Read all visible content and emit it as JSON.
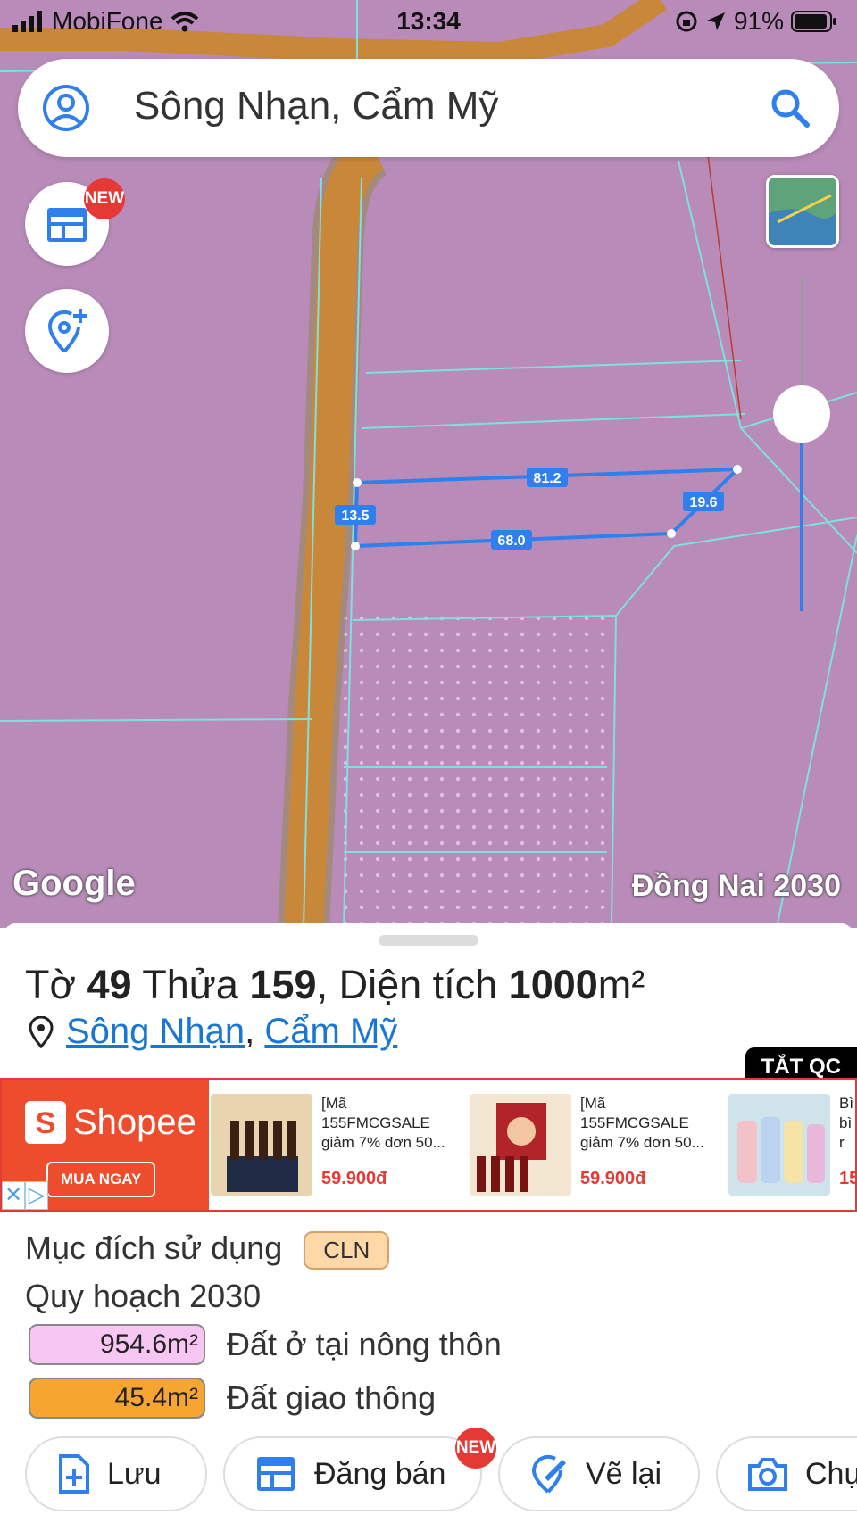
{
  "status_bar": {
    "carrier": "MobiFone",
    "time": "13:34",
    "battery": "91%"
  },
  "search": {
    "query": "Sông Nhạn, Cẩm Mỹ"
  },
  "map": {
    "badge_new": "NEW",
    "attribution": "Google",
    "layer_label": "Đồng Nai 2030",
    "parcel_edges": [
      "81.2",
      "19.6",
      "68.0",
      "13.5"
    ]
  },
  "parcel": {
    "prefix_sheet": "Tờ",
    "sheet_no": "49",
    "prefix_plot": "Thửa",
    "plot_no": "159",
    "prefix_area": ", Diện tích",
    "area": "1000",
    "area_unit": "m²",
    "location_commune": "Sông Nhạn",
    "location_sep": ",",
    "location_district": "Cẩm Mỹ"
  },
  "ad": {
    "close_label": "TẮT QC",
    "brand": "Shopee",
    "buy_label": "MUA NGAY",
    "products": [
      {
        "name": "[Mã 155FMCGSALE giảm 7% đơn 50...",
        "price": "59.900đ"
      },
      {
        "name": "[Mã 155FMCGSALE giảm 7% đơn 50...",
        "price": "59.900đ"
      },
      {
        "name": "Bì bì 2 r",
        "price": "15"
      }
    ]
  },
  "land_use": {
    "purpose_label": "Mục đích sử dụng",
    "purpose_code": "CLN",
    "plan_label": "Quy hoạch 2030",
    "plan_items": [
      {
        "area": "954.6m²",
        "label": "Đất ở tại nông thôn",
        "color": "#f7c6f2"
      },
      {
        "area": "45.4m²",
        "label": "Đất giao thông",
        "color": "#f7a531"
      }
    ]
  },
  "actions": {
    "save": "Lưu",
    "list_for_sale": "Đăng bán",
    "list_badge": "NEW",
    "redraw": "Vẽ lại",
    "photo": "Chụ"
  },
  "colors": {
    "map_bg": "#b88bb8",
    "parcel_line": "#2f80ed",
    "road": "#c9873a",
    "boundary": "#7fe0e0",
    "link": "#1976d2",
    "ad_border": "#e53935"
  }
}
